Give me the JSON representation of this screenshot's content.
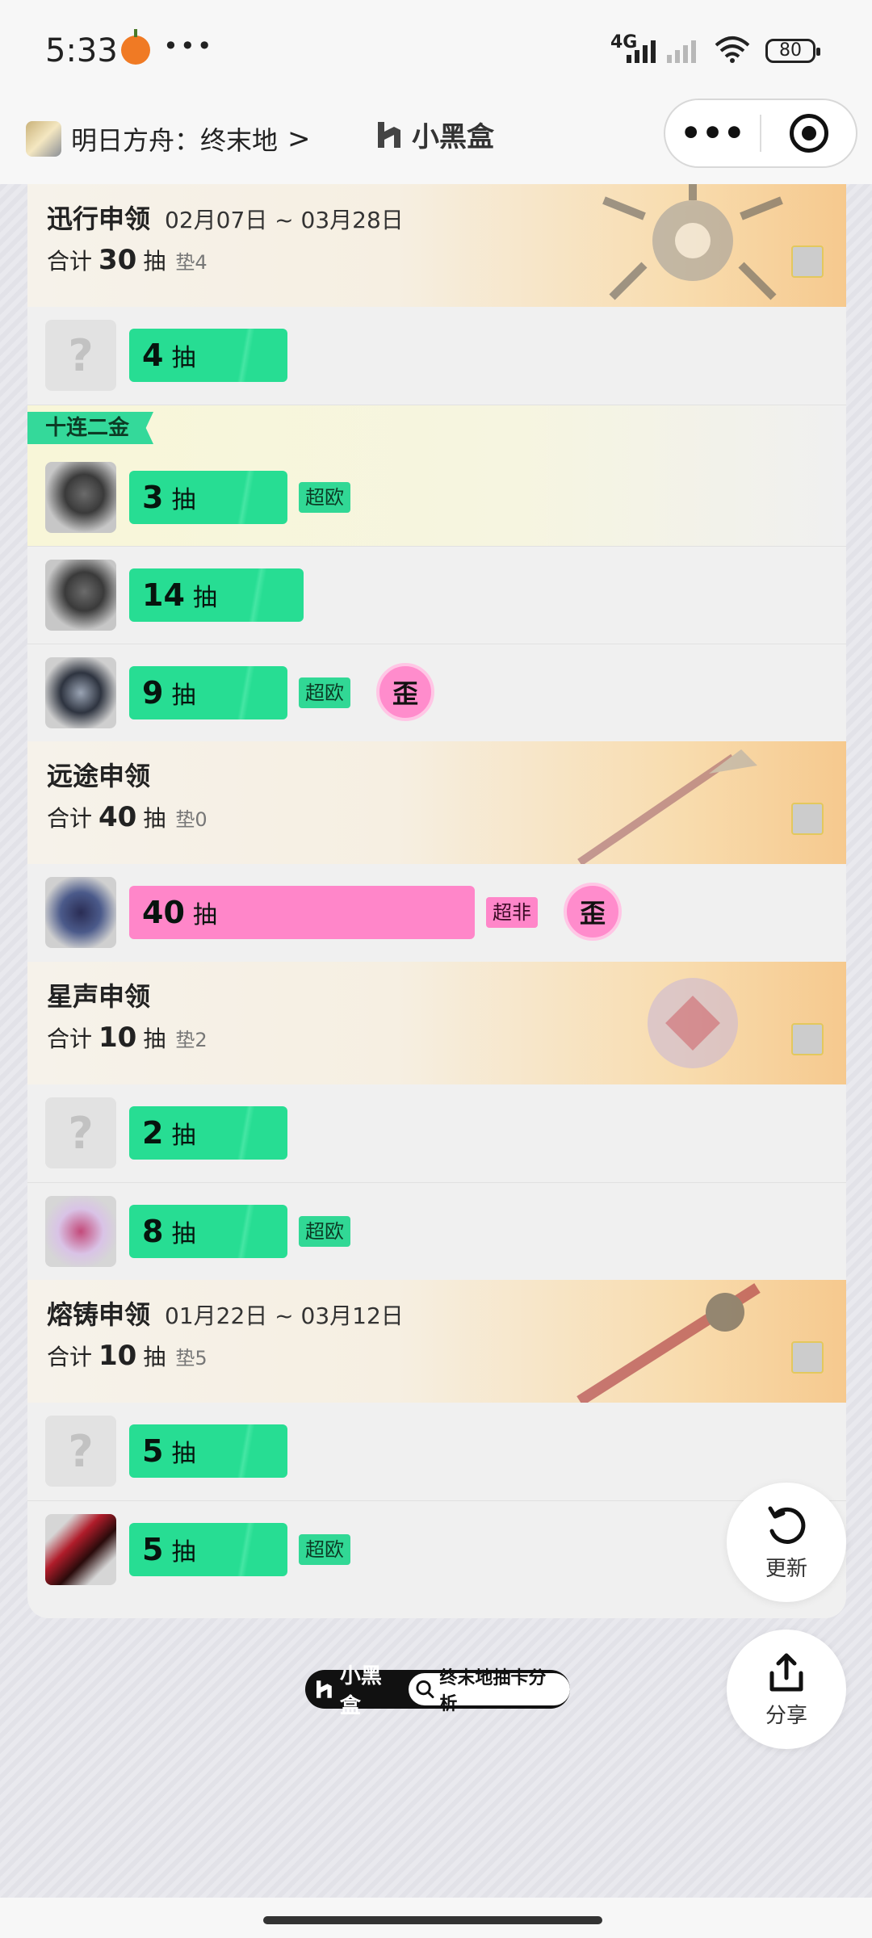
{
  "status_bar": {
    "time": "5:33",
    "network": "4G",
    "battery": "80"
  },
  "nav": {
    "game_title": "明日方舟：终末地",
    "chevron": ">",
    "brand": "小黑盒",
    "more_icon": "more-dots-icon",
    "target_icon": "miniapp-close-icon"
  },
  "pools": [
    {
      "name": "迅行申领",
      "date": "02月07日 ~ 03月28日",
      "total_prefix": "合计",
      "total": "30",
      "unit": "抽",
      "pity": "垫4",
      "pulls": [
        {
          "count": "4",
          "unit": "抽",
          "avatar": "unknown",
          "badge": "",
          "wai": ""
        },
        {
          "count": "3",
          "unit": "抽",
          "avatar": "char",
          "badge": "超欧",
          "wai": "",
          "tag": "十连二金"
        },
        {
          "count": "14",
          "unit": "抽",
          "avatar": "char",
          "badge": "",
          "wai": ""
        },
        {
          "count": "9",
          "unit": "抽",
          "avatar": "char2",
          "badge": "超欧",
          "wai": "歪"
        }
      ]
    },
    {
      "name": "远途申领",
      "date": "",
      "total_prefix": "合计",
      "total": "40",
      "unit": "抽",
      "pity": "垫0",
      "pulls": [
        {
          "count": "40",
          "unit": "抽",
          "avatar": "char3",
          "badge": "超非",
          "wai": "歪"
        }
      ]
    },
    {
      "name": "星声申领",
      "date": "",
      "total_prefix": "合计",
      "total": "10",
      "unit": "抽",
      "pity": "垫2",
      "pulls": [
        {
          "count": "2",
          "unit": "抽",
          "avatar": "unknown",
          "badge": "",
          "wai": ""
        },
        {
          "count": "8",
          "unit": "抽",
          "avatar": "char4",
          "badge": "超欧",
          "wai": ""
        }
      ]
    },
    {
      "name": "熔铸申领",
      "date": "01月22日 ~ 03月12日",
      "total_prefix": "合计",
      "total": "10",
      "unit": "抽",
      "pity": "垫5",
      "pulls": [
        {
          "count": "5",
          "unit": "抽",
          "avatar": "unknown",
          "badge": "",
          "wai": ""
        },
        {
          "count": "5",
          "unit": "抽",
          "avatar": "char5",
          "badge": "超欧",
          "wai": ""
        }
      ]
    }
  ],
  "actions": {
    "refresh_label": "更新",
    "share_label": "分享"
  },
  "footer": {
    "brand": "小黑盒",
    "search_text": "终末地抽卡分析"
  },
  "colors": {
    "green_bar": "#27dd93",
    "pink_bar": "#ff86c9",
    "banner_orange": "#f6c98e"
  }
}
